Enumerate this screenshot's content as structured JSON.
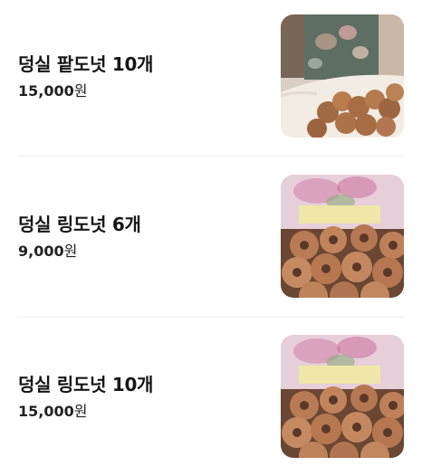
{
  "items": [
    {
      "name": "덩실 팥도넛 10개",
      "price_amount": "15,000",
      "price_unit": "원",
      "image": "red-bean-donut-photo"
    },
    {
      "name": "덩실 링도넛 6개",
      "price_amount": "9,000",
      "price_unit": "원",
      "image": "ring-donut-photo"
    },
    {
      "name": "덩실 링도넛 10개",
      "price_amount": "15,000",
      "price_unit": "원",
      "image": "ring-donut-photo"
    }
  ]
}
